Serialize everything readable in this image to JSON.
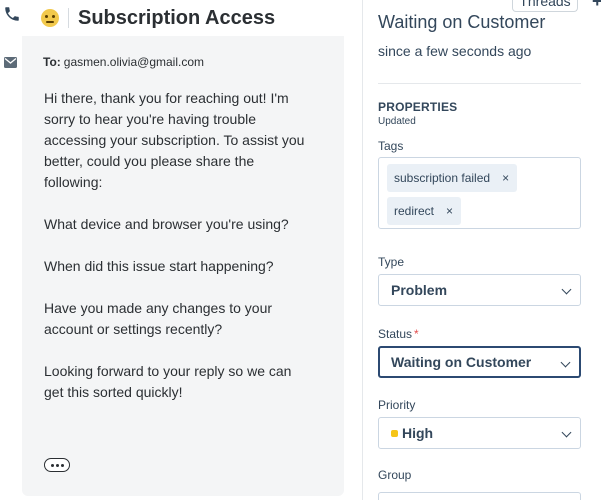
{
  "conversation": {
    "title": "Subscription Access",
    "to_label": "To:",
    "to_email": "gasmen.olivia@gmail.com",
    "paragraphs": [
      "Hi there, thank you for reaching out! I'm sorry to hear you're having trouble accessing your subscription. To assist you better, could you please share the following:",
      "What device and browser you're using?",
      "When did this issue start happening?",
      "Have you made any changes to your account or settings recently?",
      "Looking forward to your reply so we can get this sorted quickly!"
    ]
  },
  "sidebar": {
    "threads_tab": "Threads",
    "status_title": "Waiting on Customer",
    "since": "since a few seconds ago",
    "properties_heading": "PROPERTIES",
    "updated_label": "Updated",
    "tags_label": "Tags",
    "tags": [
      "subscription failed",
      "redirect"
    ],
    "type_label": "Type",
    "type_value": "Problem",
    "status_label": "Status",
    "status_required": "*",
    "status_value": "Waiting on Customer",
    "priority_label": "Priority",
    "priority_value": "High",
    "priority_color": "#f5c518",
    "group_label": "Group"
  },
  "icons": {
    "phone": "phone-icon",
    "mail": "mail-icon",
    "emoji": "neutral-face-emoji-icon",
    "more": "ellipsis-icon",
    "tag_remove": "×",
    "plus": "+"
  }
}
